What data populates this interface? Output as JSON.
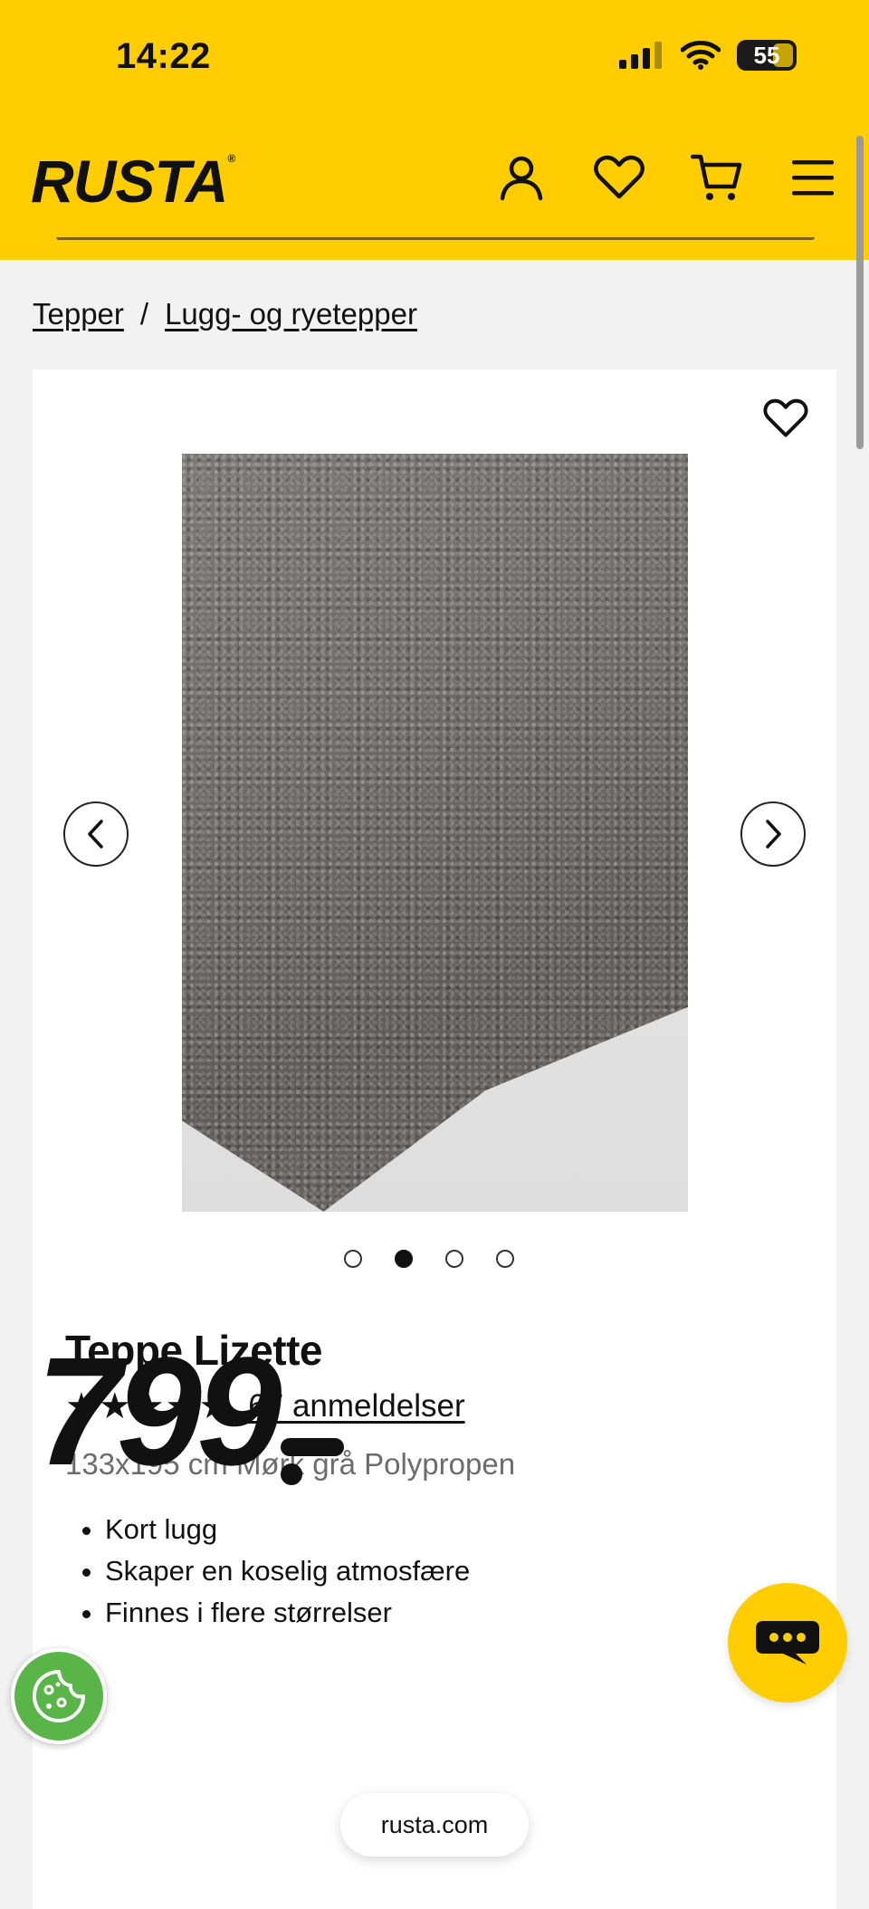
{
  "status_bar": {
    "time": "14:22",
    "battery": "55"
  },
  "header": {
    "logo_text": "RUSTA",
    "logo_mark": "®",
    "icons": [
      "account-icon",
      "wishlist-icon",
      "cart-icon",
      "menu-icon"
    ],
    "background_color": "#ffcd00"
  },
  "breadcrumb": {
    "items": [
      "Tepper",
      "Lugg- og ryetepper"
    ],
    "separator": "/"
  },
  "product": {
    "title": "Teppe Lizette",
    "rating": 5,
    "stars": "★★★★★",
    "reviews_label": "67 anmeldelser",
    "subtitle": "133x195 cm Mørk grå Polypropen",
    "features": [
      "Kort lugg",
      "Skaper en koselig atmosfære",
      "Finnes i flere størrelser"
    ],
    "price": "799",
    "gallery": {
      "total_images": 4,
      "active_index": 2
    }
  },
  "browser": {
    "url": "rusta.com"
  },
  "colors": {
    "brand_yellow": "#ffcd00",
    "cookie_green": "#59b547"
  }
}
